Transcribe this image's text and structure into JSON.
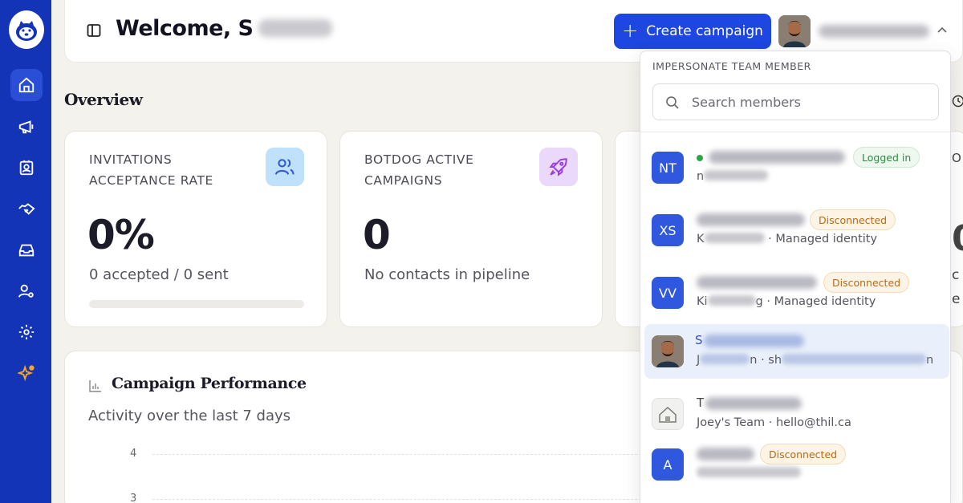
{
  "header": {
    "welcome": "Welcome, S",
    "create_campaign": "Create campaign"
  },
  "overview": {
    "title": "Overview"
  },
  "cards": [
    {
      "label": "INVITATIONS ACCEPTANCE RATE",
      "value": "0%",
      "sub": "0 accepted / 0 sent",
      "progress": 0,
      "icon": "users-icon",
      "icon_bg": "#bfe1fb"
    },
    {
      "label": "BOTDOG ACTIVE CAMPAIGNS",
      "value": "0",
      "sub": "No contacts in pipeline",
      "icon": "rocket-icon",
      "icon_bg": "#ead9fb"
    }
  ],
  "performance": {
    "title": "Campaign Performance",
    "subtitle": "Activity over the last 7 days",
    "y_ticks": [
      "4",
      "3"
    ]
  },
  "dropdown": {
    "heading": "IMPERSONATE TEAM MEMBER",
    "search_placeholder": "Search members",
    "members": [
      {
        "initials": "NT",
        "badge": "Logged in",
        "badge_type": "green",
        "line2": "n",
        "online": true
      },
      {
        "initials": "XS",
        "badge": "Disconnected",
        "badge_type": "orange",
        "line2_prefix": "K",
        "line2": " · Managed identity"
      },
      {
        "initials": "VV",
        "badge": "Disconnected",
        "badge_type": "orange",
        "line2_prefix": "Ki",
        "line2_mid": "g",
        "line2": " · Managed identity"
      },
      {
        "initials": "S",
        "badge": "",
        "line2_prefix": "J",
        "line2_mid": "n · sh",
        "line2": "n",
        "selected": true
      },
      {
        "initials": "T",
        "badge": "",
        "line2_prefix": "Joey's Team · hello@thil.ca",
        "line2": ""
      },
      {
        "initials": "A",
        "badge": "Disconnected",
        "badge_type": "orange",
        "line2": ""
      }
    ]
  },
  "colors": {
    "sidebar": "#1434b8",
    "primary": "#1e46e0",
    "background": "#f4f2ec"
  }
}
